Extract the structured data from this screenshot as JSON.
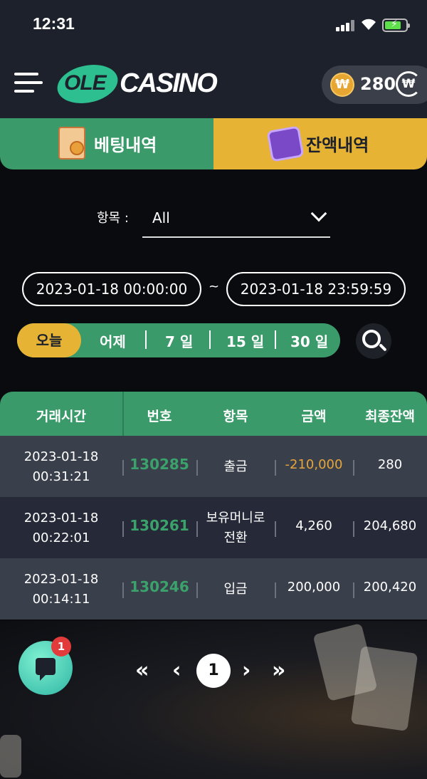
{
  "status_bar": {
    "time": "12:31"
  },
  "header": {
    "logo_ole": "OLE",
    "logo_casino": "CASINO",
    "currency_symbol": "₩",
    "balance": "280"
  },
  "tabs": [
    {
      "label": "베팅내역",
      "active": false
    },
    {
      "label": "잔액내역",
      "active": true
    }
  ],
  "filter": {
    "label": "항목 :",
    "value": "All"
  },
  "date_range": {
    "start": "2023-01-18 00:00:00",
    "separator": "~",
    "end": "2023-01-18 23:59:59"
  },
  "quick_ranges": [
    "오늘",
    "어제",
    "7 일",
    "15 일",
    "30 일"
  ],
  "table": {
    "headers": [
      "거래시간",
      "번호",
      "항목",
      "금액",
      "최종잔액"
    ],
    "rows": [
      {
        "date": "2023-01-18",
        "time": "00:31:21",
        "no": "130285",
        "type_line1": "출금",
        "type_line2": "",
        "amount": "-210,000",
        "final": "280"
      },
      {
        "date": "2023-01-18",
        "time": "00:22:01",
        "no": "130261",
        "type_line1": "보유머니로",
        "type_line2": "전환",
        "amount": "4,260",
        "final": "204,680"
      },
      {
        "date": "2023-01-18",
        "time": "00:14:11",
        "no": "130246",
        "type_line1": "입금",
        "type_line2": "",
        "amount": "200,000",
        "final": "200,420"
      }
    ]
  },
  "chat": {
    "badge_count": "1"
  },
  "pagination": {
    "first": "«",
    "prev": "‹",
    "current": "1",
    "next": "›",
    "last": "»"
  },
  "colors": {
    "green": "#3a9a6a",
    "yellow": "#e6b334",
    "header_bg": "#1d212b"
  }
}
